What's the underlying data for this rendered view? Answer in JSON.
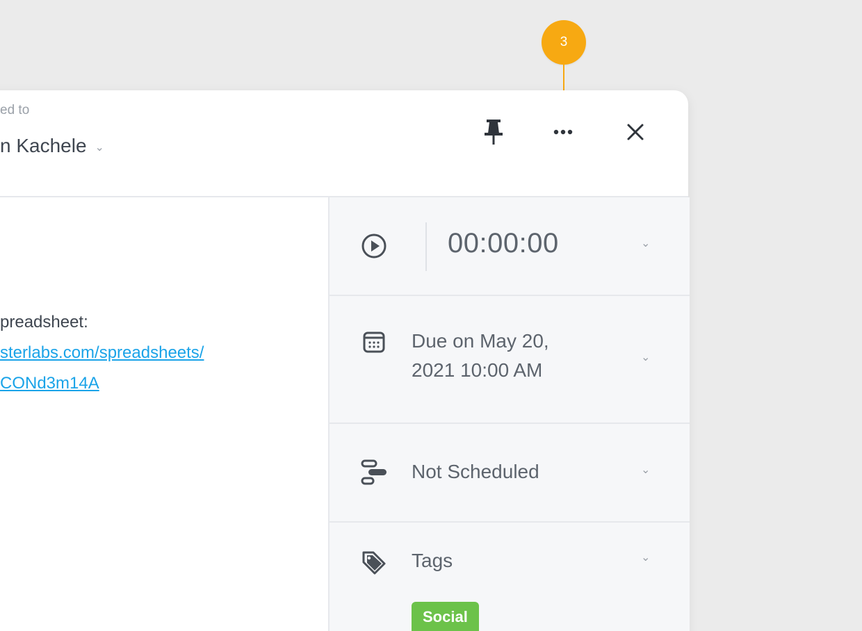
{
  "callout": {
    "number": "3"
  },
  "header": {
    "assigned_label": "ed to",
    "assignee_name": "n Kachele",
    "assignee_chevron": "⌄",
    "pin_icon": "pin-icon",
    "more_icon": "more-horizontal-icon",
    "close_icon": "close-icon"
  },
  "description": {
    "line1": "preadsheet:",
    "link_line1": "sterlabs.com/spreadsheets/",
    "link_line2": "CONd3m14A"
  },
  "sidebar": {
    "timer": {
      "icon": "play-circle-icon",
      "value": "00:00:00",
      "chevron": "⌄"
    },
    "due": {
      "icon": "calendar-icon",
      "line1": "Due on May 20,",
      "line2": "2021 10:00 AM",
      "chevron": "⌄"
    },
    "schedule": {
      "icon": "gantt-icon",
      "label": "Not Scheduled",
      "chevron": "⌄"
    },
    "tags": {
      "icon": "tag-icon",
      "label": "Tags",
      "chevron": "⌄",
      "items": [
        "Social"
      ]
    }
  },
  "colors": {
    "accent": "#f7a912",
    "link": "#1aa3e8",
    "tag_social": "#6cc24a"
  }
}
